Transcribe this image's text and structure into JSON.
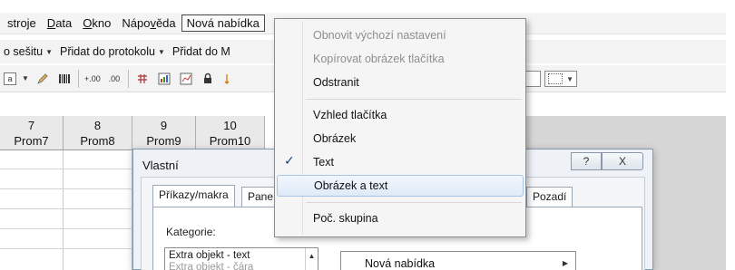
{
  "menubar": {
    "items": [
      {
        "pre": "stroje",
        "acc": "",
        "post": ""
      },
      {
        "pre": "",
        "acc": "D",
        "post": "ata"
      },
      {
        "pre": "",
        "acc": "O",
        "post": "kno"
      },
      {
        "pre": "Nápo",
        "acc": "v",
        "post": "ěda"
      },
      {
        "pre": "Nová nabídka",
        "acc": "",
        "post": ""
      }
    ]
  },
  "toolbar1": {
    "items": [
      "o sešitu",
      "Přidat do protokolu",
      "Přidat do M"
    ]
  },
  "toolbar2": {
    "icons": [
      "field-icon",
      "pencil-icon",
      "barcode-icon",
      "increase-decimal-icon",
      "decrease-decimal-icon",
      "table-icon",
      "chart-icon",
      "chart2-icon",
      "lock-icon",
      "sort-icon"
    ]
  },
  "grid": {
    "columns": [
      {
        "num": "7",
        "name": "Prom7"
      },
      {
        "num": "8",
        "name": "Prom8"
      },
      {
        "num": "9",
        "name": "Prom9"
      },
      {
        "num": "10",
        "name": "Prom10"
      }
    ]
  },
  "dialog": {
    "title": "Vlastní",
    "help_glyph": "?",
    "close_glyph": "X",
    "tabs": [
      "Příkazy/makra",
      "Pane",
      "Pozadí"
    ],
    "category_label": "Kategorie:",
    "categories": [
      "Extra objekt - text",
      "Extra objekt - čára"
    ],
    "command_item": "Nová nabídka"
  },
  "context_menu": {
    "items": [
      {
        "label": "Obnovit výchozí nastavení",
        "state": "disabled"
      },
      {
        "label": "Kopírovat obrázek tlačítka",
        "state": "disabled"
      },
      {
        "label": "Odstranit",
        "state": "normal"
      },
      {
        "label": "Vzhled tlačítka",
        "state": "normal"
      },
      {
        "label": "Obrázek",
        "state": "normal"
      },
      {
        "label": "Text",
        "state": "checked"
      },
      {
        "label": "Obrázek a text",
        "state": "hover"
      },
      {
        "label": "Poč. skupina",
        "state": "normal"
      }
    ],
    "check_glyph": "✓"
  }
}
